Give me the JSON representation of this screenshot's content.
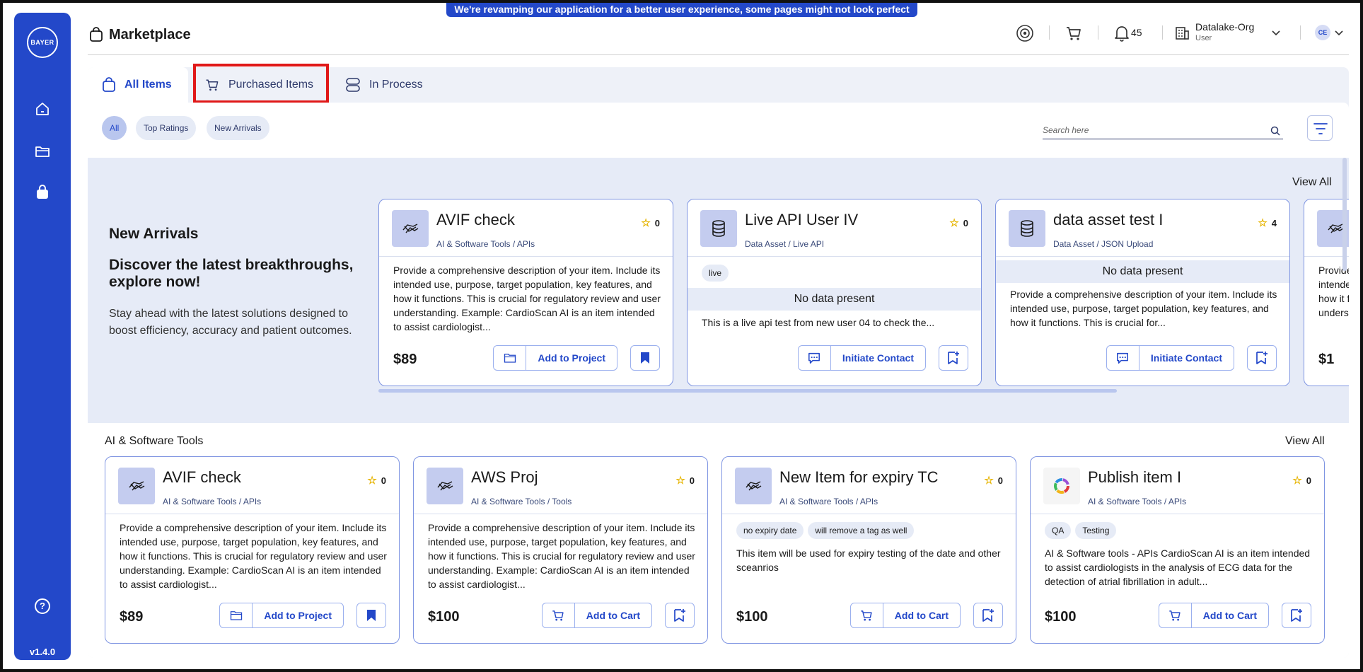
{
  "banner": "We're revamping our application for a better user experience, some pages might not look perfect yet!",
  "sidebar": {
    "logo_text": "BAYER",
    "version": "v1.4.0",
    "help": "?",
    "items": [
      {
        "icon": "home-icon"
      },
      {
        "icon": "folder-icon"
      },
      {
        "icon": "marketplace-bag-icon"
      }
    ]
  },
  "header": {
    "title": "Marketplace",
    "notifications": "45",
    "org_name": "Datalake-Org",
    "org_role": "User",
    "avatar": "CE"
  },
  "tabs": [
    {
      "label": "All Items",
      "active": true
    },
    {
      "label": "Purchased Items",
      "active": false
    },
    {
      "label": "In Process",
      "active": false
    }
  ],
  "filters": {
    "chips": [
      "All",
      "Top Ratings",
      "New Arrivals"
    ],
    "search_placeholder": "Search here"
  },
  "new_arrivals": {
    "title": "New Arrivals",
    "subtitle": "Discover the latest breakthroughs, explore now!",
    "description": "Stay ahead with the latest solutions designed to boost efficiency, accuracy and patient outcomes.",
    "view_all": "View All",
    "cards": [
      {
        "title": "AVIF check",
        "category": "AI & Software Tools / APIs",
        "rating": "0",
        "description": "Provide a comprehensive description of your item. Include its intended use, purpose, target population, key features, and how it functions. This is crucial for regulatory review and user understanding. Example: CardioScan AI is an item intended to assist cardiologist...",
        "price": "$89",
        "action": "Add to Project"
      },
      {
        "title": "Live API User IV",
        "category": "Data Asset / Live API",
        "rating": "0",
        "tag": "live",
        "no_data": "No data present",
        "description": "This is a live api test from new user 04 to check the...",
        "action": "Initiate Contact"
      },
      {
        "title": "data asset test I",
        "category": "Data Asset / JSON Upload",
        "rating": "4",
        "no_data": "No data present",
        "description": "Provide a comprehensive description of your item. Include its intended use, purpose, target population, key features, and how it functions. This is crucial for...",
        "action": "Initiate Contact"
      },
      {
        "description": "Provide a comprehensive description of your item. Include its intended use, purpose, target population, key features, and how it functions. This is crucial for regulatory review and user understanding. Example: CardioScan AI...",
        "price": "$1"
      }
    ]
  },
  "ai_tools": {
    "title": "AI & Software Tools",
    "view_all": "View All",
    "cards": [
      {
        "title": "AVIF check",
        "category": "AI & Software Tools / APIs",
        "rating": "0",
        "description": "Provide a comprehensive description of your item. Include its intended use, purpose, target population, key features, and how it functions. This is crucial for regulatory review and user understanding. Example: CardioScan AI is an item intended to assist cardiologist...",
        "price": "$89",
        "action": "Add to Project"
      },
      {
        "title": "AWS Proj",
        "category": "AI & Software Tools / Tools",
        "rating": "0",
        "description": "Provide a comprehensive description of your item. Include its intended use, purpose, target population, key features, and how it functions. This is crucial for regulatory review and user understanding. Example: CardioScan AI is an item intended to assist cardiologist...",
        "price": "$100",
        "action": "Add to Cart"
      },
      {
        "title": "New Item for expiry TC",
        "category": "AI & Software Tools / APIs",
        "rating": "0",
        "tags": [
          "no expiry date",
          "will remove a tag as well"
        ],
        "description": "This item will be used for expiry testing of the date and other sceanrios",
        "price": "$100",
        "action": "Add to Cart"
      },
      {
        "title": "Publish item I",
        "category": "AI & Software Tools / APIs",
        "rating": "0",
        "tags": [
          "QA",
          "Testing"
        ],
        "description": "AI & Software tools - APIs CardioScan AI is an item intended to assist cardiologists in the analysis of ECG data for the detection of atrial fibrillation in adult...",
        "price": "$100",
        "action": "Add to Cart"
      }
    ]
  },
  "colors": {
    "primary": "#2348c9",
    "band": "#e6ebf7",
    "highlight": "#e01818",
    "star": "#e6b400"
  }
}
